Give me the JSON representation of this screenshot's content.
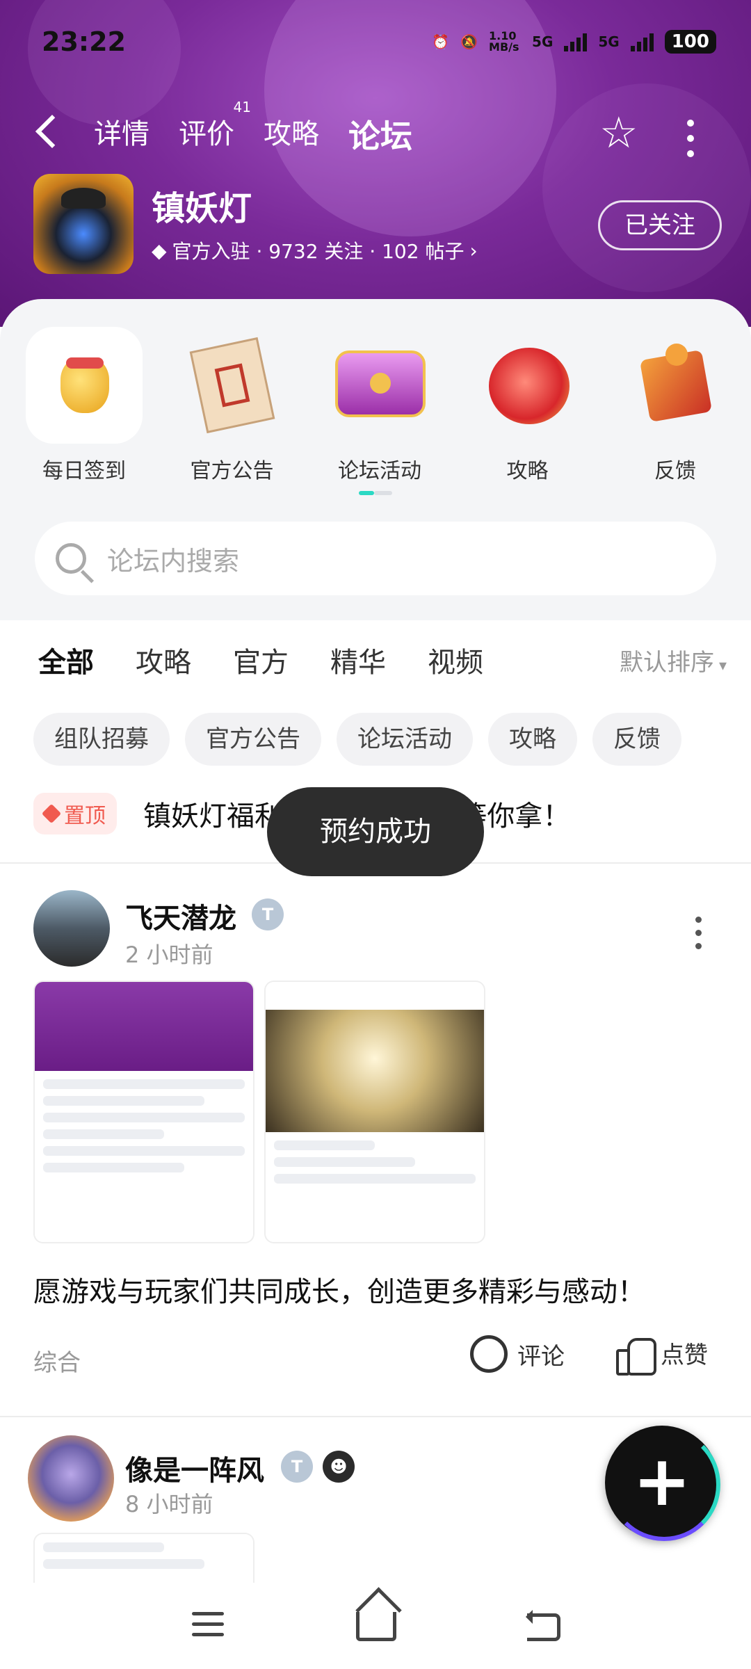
{
  "status_bar": {
    "time": "23:22",
    "net_speed": "1.10 MB/s",
    "network1": "5G",
    "network2": "5G",
    "battery": "100"
  },
  "nav": {
    "tabs": [
      {
        "label": "详情",
        "count": ""
      },
      {
        "label": "评价",
        "count": "41"
      },
      {
        "label": "攻略",
        "count": ""
      },
      {
        "label": "论坛",
        "count": ""
      }
    ],
    "active_tab": "论坛"
  },
  "game": {
    "name": "镇妖灯",
    "meta": "官方入驻 · 9732 关注 · 102 帖子",
    "follow_label": "已关注"
  },
  "shortcuts": [
    {
      "label": "每日签到",
      "icon": "lucky-bag-icon"
    },
    {
      "label": "官方公告",
      "icon": "scroll-icon"
    },
    {
      "label": "论坛活动",
      "icon": "treasure-chest-icon"
    },
    {
      "label": "攻略",
      "icon": "dragon-icon"
    },
    {
      "label": "反馈",
      "icon": "puzzle-icon"
    }
  ],
  "search": {
    "placeholder": "论坛内搜索"
  },
  "filter_tabs": [
    "全部",
    "攻略",
    "官方",
    "精华",
    "视频"
  ],
  "sort_label": "默认排序",
  "chips": [
    "组队招募",
    "官方公告",
    "论坛活动",
    "攻略",
    "反馈"
  ],
  "pinned": {
    "tag": "置顶",
    "text": "镇妖灯福利汇总-千抽狂欢等你拿！"
  },
  "toast": "预约成功",
  "posts": [
    {
      "author": "飞天潜龙",
      "time": "2 小时前",
      "text": "愿游戏与玩家们共同成长，创造更多精彩与感动！",
      "category": "综合",
      "comment_label": "评论",
      "like_label": "点赞"
    },
    {
      "author": "像是一阵风",
      "time": "8 小时前"
    }
  ],
  "colors": {
    "accent": "#2bd9c4",
    "header_purple": "#7a2a99",
    "pin_red": "#f05a4f"
  }
}
